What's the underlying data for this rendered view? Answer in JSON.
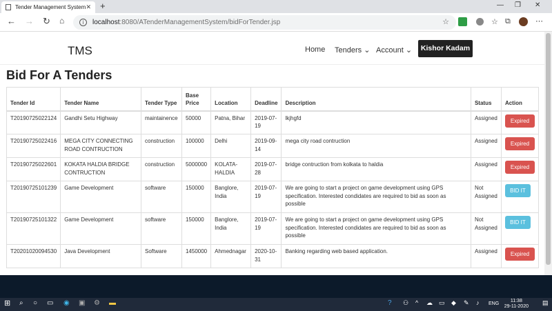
{
  "browser": {
    "tab_title": "Tender Management System",
    "url_host": "localhost",
    "url_path": ":8080/ATenderManagementSystem/bidForTender.jsp"
  },
  "nav": {
    "brand": "TMS",
    "home": "Home",
    "tenders": "Tenders",
    "account": "Account",
    "user": "Kishor Kadam"
  },
  "page": {
    "title": "Bid For A Tenders"
  },
  "table": {
    "headers": [
      "Tender Id",
      "Tender Name",
      "Tender Type",
      "Base Price",
      "Location",
      "Deadline",
      "Description",
      "Status",
      "Action"
    ],
    "rows": [
      {
        "id": "T20190725022124",
        "name": "Gandhi Setu Highway",
        "type": "maintainence",
        "price": "50000",
        "location": "Patna, Bihar",
        "deadline": "2019-07-19",
        "description": "lkjhgfd",
        "status": "Assigned",
        "action": "Expired"
      },
      {
        "id": "T20190725022416",
        "name": "MEGA CITY CONNECTING ROAD CONTRUCTION",
        "type": "construction",
        "price": "100000",
        "location": "Delhi",
        "deadline": "2019-09-14",
        "description": "mega city road contruction",
        "status": "Assigned",
        "action": "Expired"
      },
      {
        "id": "T20190725022601",
        "name": "KOKATA HALDIA BRIDGE CONTRUCTION",
        "type": "construction",
        "price": "5000000",
        "location": "KOLATA-HALDIA",
        "deadline": "2019-07-28",
        "description": "bridge contruction from kolkata to haldia",
        "status": "Assigned",
        "action": "Expired"
      },
      {
        "id": "T20190725101239",
        "name": "Game Development",
        "type": "software",
        "price": "150000",
        "location": "Banglore, India",
        "deadline": "2019-07-19",
        "description": "We are going to start a project on game development using GPS specification. Interested condidates are required to bid as soon as possible",
        "status": "Not Assigned",
        "action": "BID IT"
      },
      {
        "id": "T20190725101322",
        "name": "Game Development",
        "type": "software",
        "price": "150000",
        "location": "Banglore, India",
        "deadline": "2019-07-19",
        "description": "We are going to start a project on game development using GPS specification. Interested condidates are required to bid as soon as possible",
        "status": "Not Assigned",
        "action": "BID IT"
      },
      {
        "id": "T20201020094530",
        "name": "Java Development",
        "type": "Software",
        "price": "1450000",
        "location": "Ahmednagar",
        "deadline": "2020-10-31",
        "description": "Banking regarding web based application.",
        "status": "Assigned",
        "action": "Expired"
      }
    ]
  },
  "taskbar": {
    "lang": "ENG",
    "time": "11:38",
    "date": "29-11-2020"
  },
  "colors": {
    "expired": "#d9534f",
    "bid": "#5bc0de",
    "navbar_button": "#222222",
    "footer": "#0c1a2a"
  }
}
